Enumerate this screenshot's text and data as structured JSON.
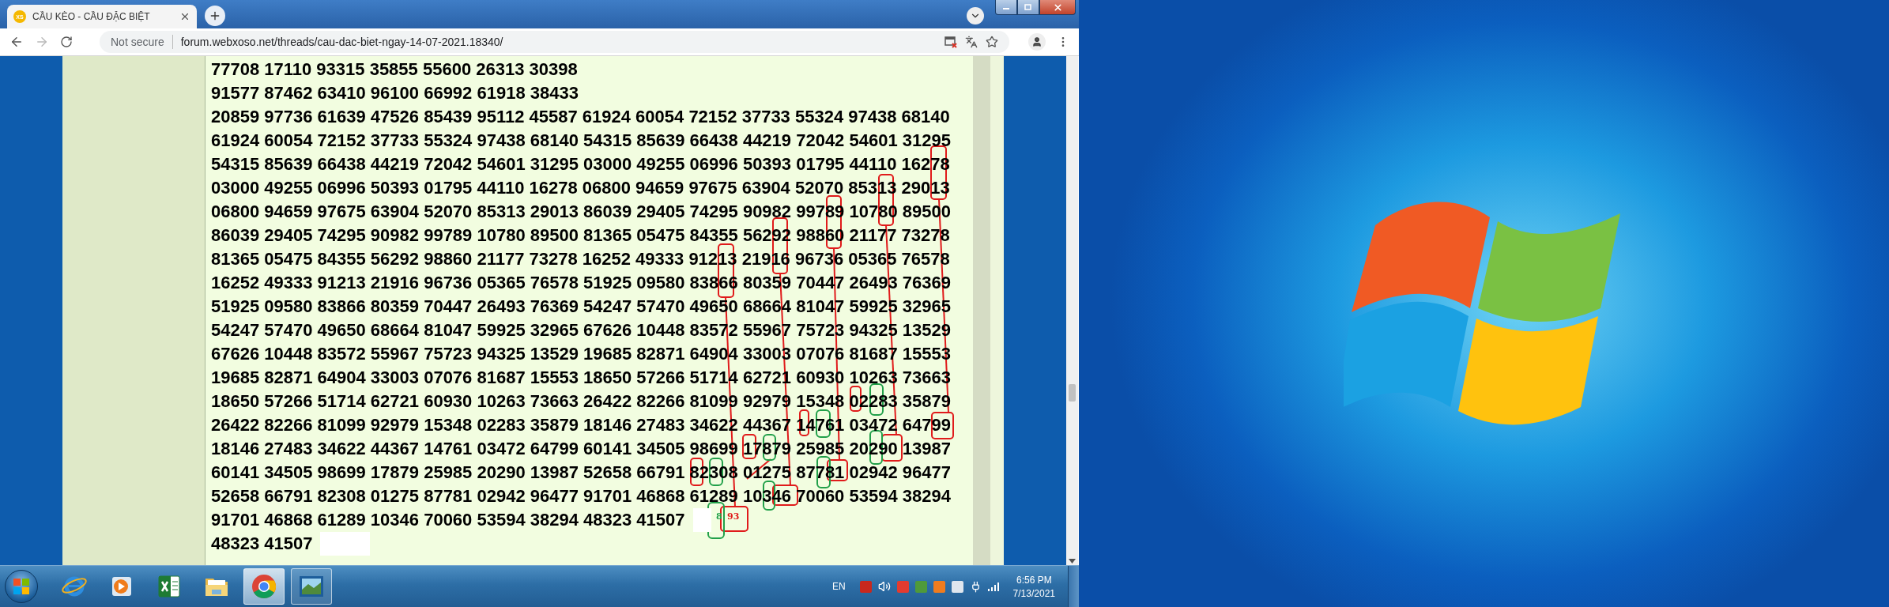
{
  "browser": {
    "tab": {
      "favicon_text": "XS",
      "title": "CẦU KÈO - CẦU ĐẶC BIỆT"
    },
    "address_bar": {
      "security_label": "Not secure",
      "url": "forum.webxoso.net/threads/cau-dac-biet-ngay-14-07-2021.18340/"
    }
  },
  "post": {
    "lines": [
      {
        "text": "77708 17110 93315 35855 55600 26313 30398",
        "blank_after": false
      },
      {
        "text": "91577 87462 63410 96100 66992 61918 38433",
        "blank_after": false
      },
      {
        "text": "20859 97736 61639 47526 85439 95112 45587 61924 60054 72152 37733 55324 97438 68140",
        "blank_after": false
      },
      {
        "text": "61924 60054 72152 37733 55324 97438 68140 54315 85639 66438 44219 72042 54601 31295",
        "blank_after": false
      },
      {
        "text": "54315 85639 66438 44219 72042 54601 31295 03000 49255 06996 50393 01795 44110 16278",
        "blank_after": false
      },
      {
        "text": "03000 49255 06996 50393 01795 44110 16278 06800 94659 97675 63904 52070 85313 29013",
        "blank_after": false
      },
      {
        "text": "06800 94659 97675 63904 52070 85313 29013 86039 29405 74295 90982 99789 10780 89500",
        "blank_after": false
      },
      {
        "text": "86039 29405 74295 90982 99789 10780 89500 81365 05475 84355 56292 98860 21177 73278",
        "blank_after": false
      },
      {
        "text": "81365 05475 84355 56292 98860 21177 73278 16252 49333 91213 21916 96736 05365 76578",
        "blank_after": false
      },
      {
        "text": "16252 49333 91213 21916 96736 05365 76578 51925 09580 83866 80359 70447 26493 76369",
        "blank_after": false
      },
      {
        "text": "51925 09580 83866 80359 70447 26493 76369 54247 57470 49650 68664 81047 59925 32965",
        "blank_after": false
      },
      {
        "text": "54247 57470 49650 68664 81047 59925 32965 67626 10448 83572 55967 75723 94325 13529",
        "blank_after": false
      },
      {
        "text": "67626 10448 83572 55967 75723 94325 13529 19685 82871 64904 33003 07076 81687 15553",
        "blank_after": false
      },
      {
        "text": "19685 82871 64904 33003 07076 81687 15553 18650 57266 51714 62721 60930 10263 73663",
        "blank_after": false
      },
      {
        "text": "18650 57266 51714 62721 60930 10263 73663 26422 82266 81099 92979 15348 02283 35879",
        "blank_after": false
      },
      {
        "text": "26422 82266 81099 92979 15348 02283 35879 18146 27483 34622 44367 14761 03472 64799",
        "blank_after": false
      },
      {
        "text": "18146 27483 34622 44367 14761 03472 64799 60141 34505 98699 17879 25985 20290 13987",
        "blank_after": false
      },
      {
        "text": "60141 34505 98699 17879 25985 20290 13987 52658 66791 82308 01275 87781 02942 96477",
        "blank_after": false
      },
      {
        "text": "52658 66791 82308 01275 87781 02942 96477 91701 46868 61289 10346 70060 53594 38294",
        "blank_after": false
      },
      {
        "text": "91701 46868 61289 10346 70060 53594 38294 48323 41507",
        "blank_after": true
      },
      {
        "text": "48323 41507",
        "blank_after": true
      }
    ],
    "annotation_labels": [
      {
        "text": "8",
        "color": "#22a04a"
      },
      {
        "text": "93",
        "color": "#e01b1b"
      }
    ]
  },
  "taskbar": {
    "buttons": [
      {
        "running": false,
        "selected": false
      },
      {
        "running": false,
        "selected": false
      },
      {
        "running": false,
        "selected": false
      },
      {
        "running": false,
        "selected": false
      },
      {
        "running": true,
        "selected": true
      },
      {
        "running": true,
        "selected": false
      }
    ],
    "language": "EN",
    "time": "6:56 PM",
    "date": "7/13/2021"
  }
}
